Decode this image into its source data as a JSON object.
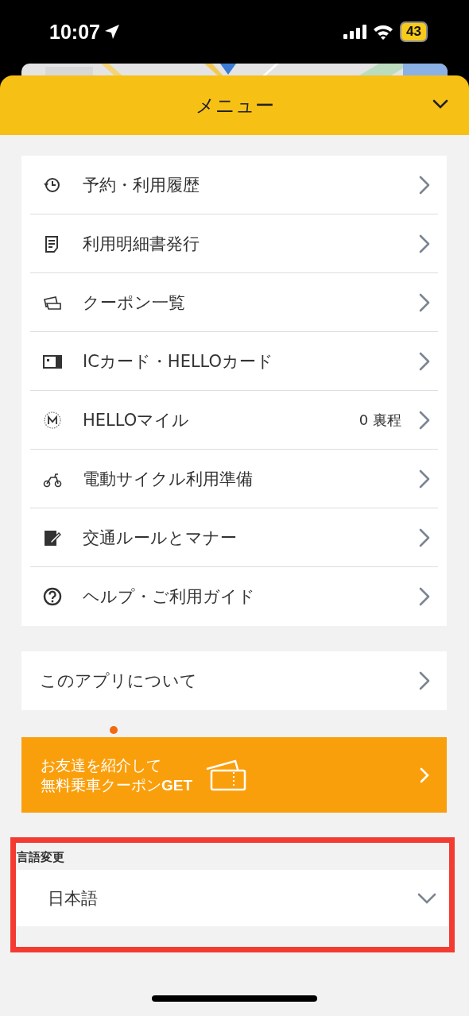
{
  "status_bar": {
    "time": "10:07",
    "battery": "43"
  },
  "header": {
    "title": "メニュー"
  },
  "menu": {
    "items": [
      {
        "label": "予約・利用履歴"
      },
      {
        "label": "利用明細書発行"
      },
      {
        "label": "クーポン一覧"
      },
      {
        "label": "ICカード・HELLOカード"
      },
      {
        "label": "HELLOマイル",
        "value": "0 裏程"
      },
      {
        "label": "電動サイクル利用準備"
      },
      {
        "label": "交通ルールとマナー"
      },
      {
        "label": "ヘルプ・ご利用ガイド"
      }
    ]
  },
  "about": {
    "label": "このアプリについて"
  },
  "referral_banner": {
    "new_badge": true,
    "lines": [
      "お友達を紹介して",
      "無料乗車クーポン**GET**"
    ]
  },
  "language": {
    "label": "言語変更",
    "value": "日本語",
    "highlighted": true
  }
}
